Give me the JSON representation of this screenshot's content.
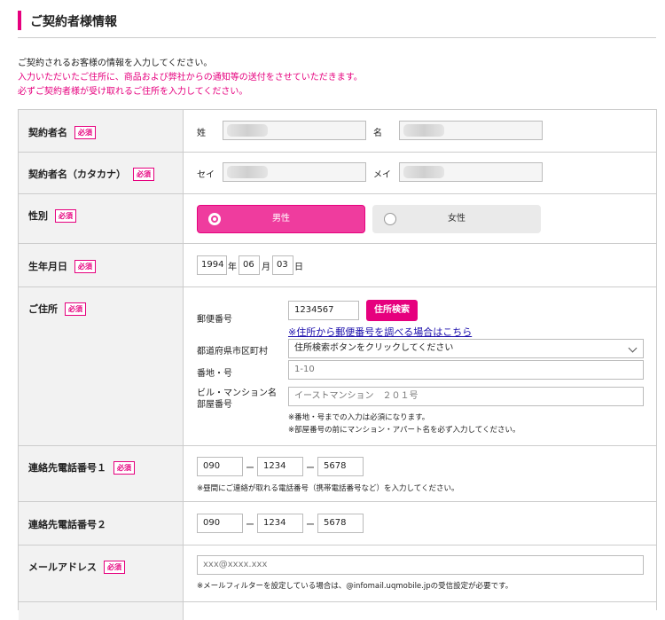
{
  "header": {
    "title": "ご契約者様情報"
  },
  "intro": {
    "line1": "ご契約されるお客様の情報を入力してください。",
    "line2": "入力いただいたご住所に、商品および弊社からの通知等の送付をさせていただきます。",
    "line3": "必ずご契約者様が受け取れるご住所を入力してください。"
  },
  "required_badge": "必須",
  "name": {
    "label": "契約者名",
    "last_label": "姓",
    "first_label": "名"
  },
  "kana": {
    "label": "契約者名（カタカナ）",
    "last_label": "セイ",
    "first_label": "メイ"
  },
  "gender": {
    "label": "性別",
    "male": "男性",
    "female": "女性",
    "selected": "男性"
  },
  "birth": {
    "label": "生年月日",
    "year": "1994",
    "year_unit": "年",
    "month": "06",
    "month_unit": "月",
    "day": "03",
    "day_unit": "日"
  },
  "address": {
    "label": "ご住所",
    "postal_label": "郵便番号",
    "postal_value": "1234567",
    "search_button": "住所検索",
    "postal_link": "※住所から郵便番号を調べる場合はこちら",
    "pref_label": "都道府県市区町村",
    "pref_value": "住所検索ボタンをクリックしてください",
    "banchi_label": "番地・号",
    "banchi_placeholder": "1-10",
    "building_label_1": "ビル・マンション名",
    "building_label_2": "部屋番号",
    "building_placeholder": "イーストマンション　２０１号",
    "note1": "※番地・号までの入力は必須になります。",
    "note2": "※部屋番号の前にマンション・アパート名を必ず入力してください。"
  },
  "phone1": {
    "label": "連絡先電話番号１",
    "p1": "090",
    "p2": "1234",
    "p3": "5678",
    "sep": "ー",
    "note": "※昼間にご連絡が取れる電話番号（携帯電話番号など）を入力してください。"
  },
  "phone2": {
    "label": "連絡先電話番号２",
    "p1": "090",
    "p2": "1234",
    "p3": "5678",
    "sep": "ー"
  },
  "email": {
    "label": "メールアドレス",
    "placeholder": "xxx@xxxx.xxx",
    "note": "※メールフィルターを設定している場合は、@infomail.uqmobile.jpの受信設定が必要です。"
  },
  "colors": {
    "accent": "#e6007e",
    "male_button": "#ef3c9e",
    "link": "#1a0dab"
  }
}
